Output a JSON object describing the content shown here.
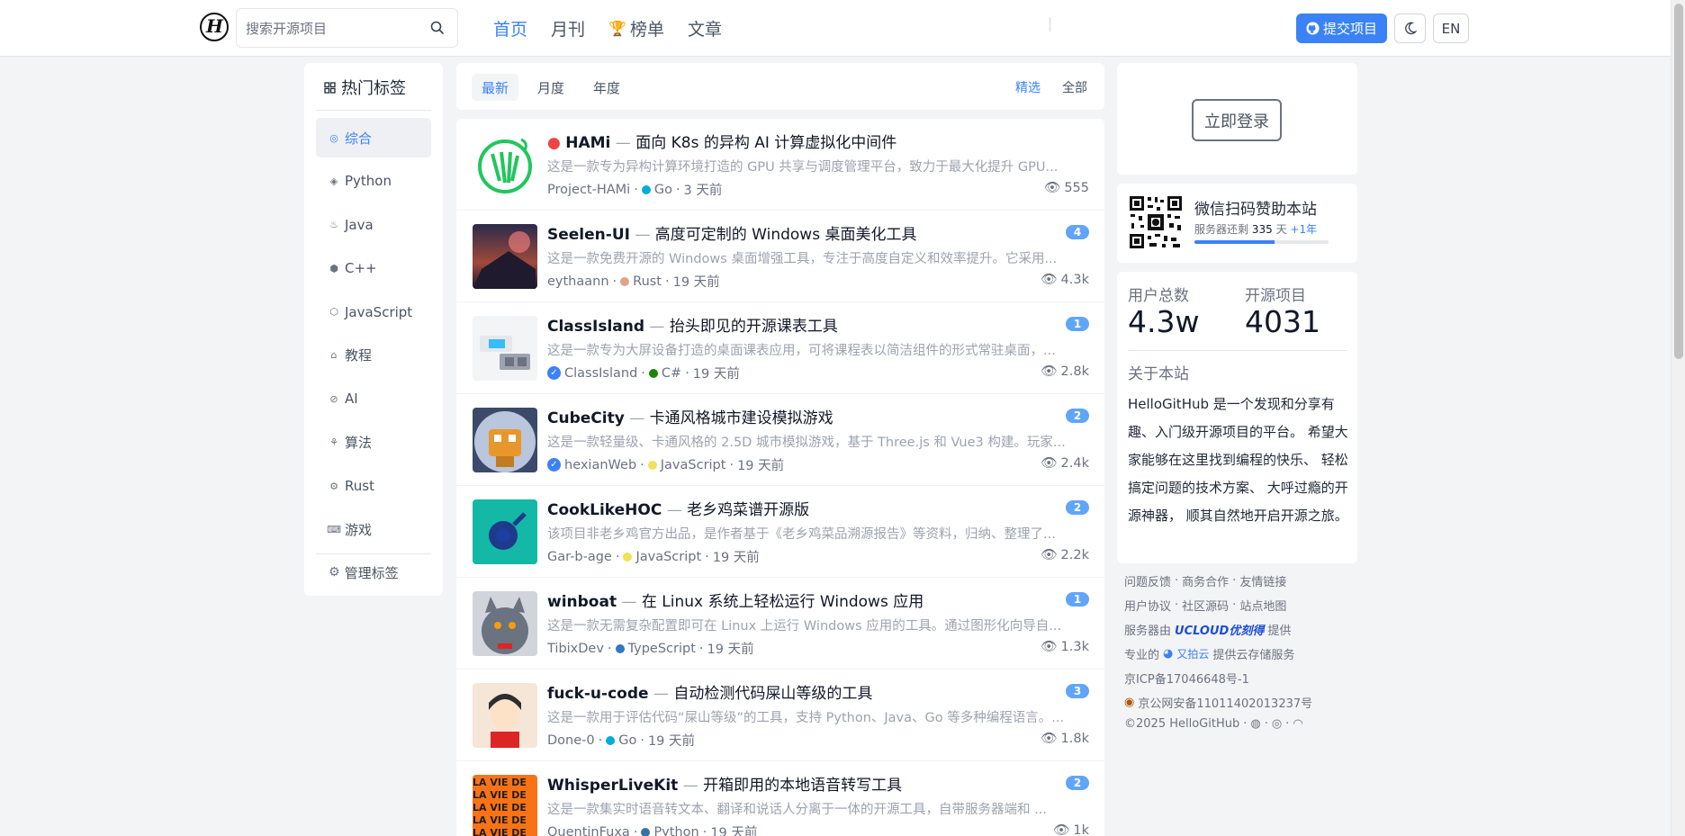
{
  "header": {
    "search_placeholder": "搜索开源项目",
    "nav": [
      "首页",
      "月刊",
      "榜单",
      "文章"
    ],
    "submit_label": "提交项目",
    "lang_label": "EN"
  },
  "tags": {
    "title": "热门标签",
    "items": [
      "综合",
      "Python",
      "Java",
      "C++",
      "JavaScript",
      "教程",
      "AI",
      "算法",
      "Rust",
      "游戏"
    ],
    "manage": "管理标签"
  },
  "tabs": [
    "最新",
    "月度",
    "年度"
  ],
  "filters": [
    "精选",
    "全部"
  ],
  "projects": [
    {
      "name": "HAMi",
      "desc_title": "面向 K8s 的异构 AI 计算虚拟化中间件",
      "desc": "这是一款专为异构计算环境打造的 GPU 共享与调度管理平台，致力于最大化提升 GPU...",
      "author": "Project-HAMi",
      "lang": "Go",
      "lang_color": "#00ADD8",
      "time": "3 天前",
      "views": "555",
      "badge": "",
      "verified": false
    },
    {
      "name": "Seelen-UI",
      "desc_title": "高度可定制的 Windows 桌面美化工具",
      "desc": "这是一款免费开源的 Windows 桌面增强工具，专注于高度自定义和效率提升。它采用...",
      "author": "eythaann",
      "lang": "Rust",
      "lang_color": "#dea584",
      "time": "19 天前",
      "views": "4.3k",
      "badge": "4",
      "verified": false
    },
    {
      "name": "ClassIsland",
      "desc_title": "抬头即见的开源课表工具",
      "desc": "这是一款专为大屏设备打造的桌面课表应用，可将课程表以简洁组件的形式常驻桌面，...",
      "author": "ClassIsland",
      "lang": "C#",
      "lang_color": "#178600",
      "time": "19 天前",
      "views": "2.8k",
      "badge": "1",
      "verified": true
    },
    {
      "name": "CubeCity",
      "desc_title": "卡通风格城市建设模拟游戏",
      "desc": "这是一款轻量级、卡通风格的 2.5D 城市模拟游戏，基于 Three.js 和 Vue3 构建。玩家...",
      "author": "hexianWeb",
      "lang": "JavaScript",
      "lang_color": "#f1e05a",
      "time": "19 天前",
      "views": "2.4k",
      "badge": "2",
      "verified": true
    },
    {
      "name": "CookLikeHOC",
      "desc_title": "老乡鸡菜谱开源版",
      "desc": "该项目非老乡鸡官方出品，是作者基于《老乡鸡菜品溯源报告》等资料，归纳、整理了...",
      "author": "Gar-b-age",
      "lang": "JavaScript",
      "lang_color": "#f1e05a",
      "time": "19 天前",
      "views": "2.2k",
      "badge": "2",
      "verified": false
    },
    {
      "name": "winboat",
      "desc_title": "在 Linux 系统上轻松运行 Windows 应用",
      "desc": "这是一款无需复杂配置即可在 Linux 上运行 Windows 应用的工具。通过图形化向导自...",
      "author": "TibixDev",
      "lang": "TypeScript",
      "lang_color": "#3178c6",
      "time": "19 天前",
      "views": "1.3k",
      "badge": "1",
      "verified": false
    },
    {
      "name": "fuck-u-code",
      "desc_title": "自动检测代码屎山等级的工具",
      "desc": "这是一款用于评估代码“屎山等级”的工具，支持 Python、Java、Go 等多种编程语言。...",
      "author": "Done-0",
      "lang": "Go",
      "lang_color": "#00ADD8",
      "time": "19 天前",
      "views": "1.8k",
      "badge": "3",
      "verified": false
    },
    {
      "name": "WhisperLiveKit",
      "desc_title": "开箱即用的本地语音转写工具",
      "desc": "这是一款集实时语音转文本、翻译和说话人分离于一体的开源工具，自带服务器端和 ...",
      "author": "QuentinFuxa",
      "lang": "Python",
      "lang_color": "#3572A5",
      "time": "19 天前",
      "views": "1k",
      "badge": "2",
      "verified": false
    }
  ],
  "login": {
    "label": "立即登录"
  },
  "sponsor": {
    "title": "微信扫码赞助本站",
    "sub_prefix": "服务器还剩",
    "days": "335",
    "sub_unit": "天",
    "plus": "+1年",
    "progress": 0.6
  },
  "stats": {
    "users_label": "用户总数",
    "users_value": "4.3w",
    "projects_label": "开源项目",
    "projects_value": "4031"
  },
  "about": {
    "title": "关于本站",
    "text": "HelloGitHub 是一个发现和分享有趣、入门级开源项目的平台。 希望大家能够在这里找到编程的快乐、 轻松搞定问题的技术方案、 大呼过瘾的开源神器， 顺其自然地开启开源之旅。"
  },
  "footer": {
    "row1": [
      "问题反馈",
      "商务合作",
      "友情链接"
    ],
    "row2": [
      "用户协议",
      "社区源码",
      "站点地图"
    ],
    "server_prefix": "服务器由",
    "server_brand": "UCLOUD优刻得",
    "server_suffix": "提供",
    "storage_prefix": "专业的",
    "storage_brand": "又拍云",
    "storage_suffix": "提供云存储服务",
    "icp": "京ICP备17046648号-1",
    "police": "京公网安备11011402013237号",
    "copyright": "©2025 HelloGitHub"
  }
}
